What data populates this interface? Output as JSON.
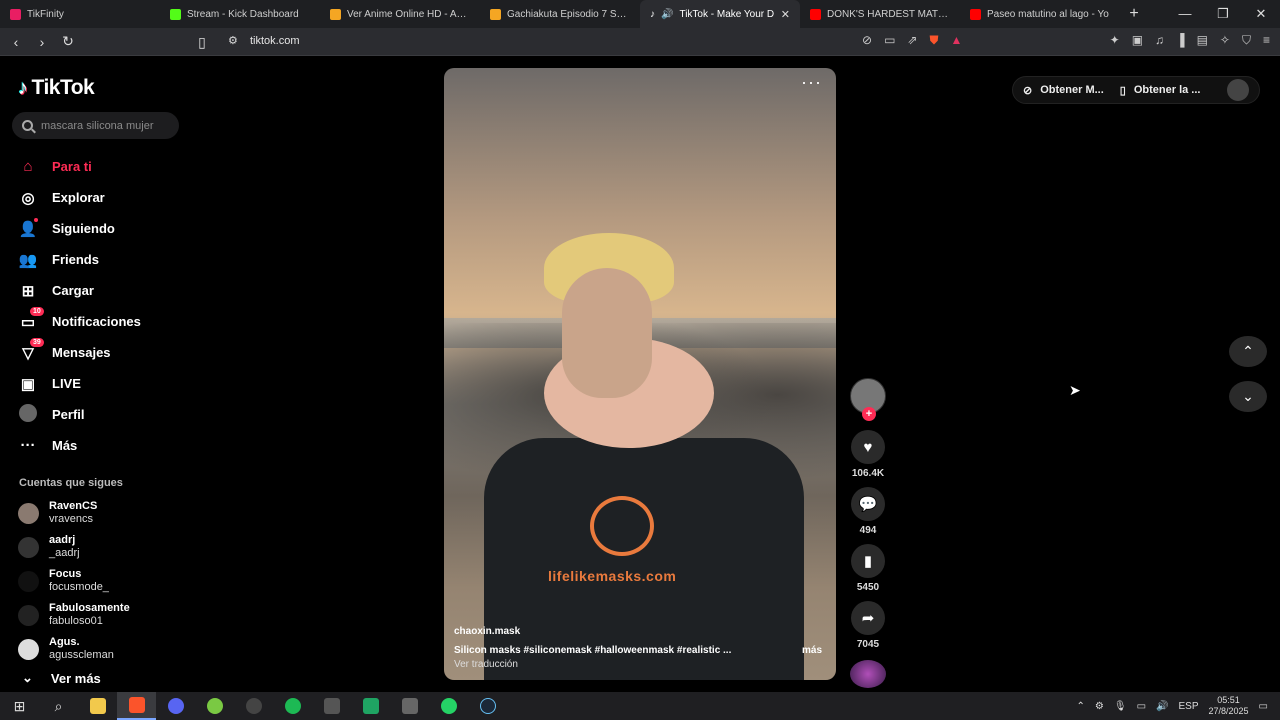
{
  "browser": {
    "tabs": [
      {
        "label": "TikFinity",
        "color": "#e91e63",
        "active": false
      },
      {
        "label": "Stream - Kick Dashboard",
        "color": "#53fc18",
        "active": false
      },
      {
        "label": "Ver Anime Online HD - Anim",
        "color": "#f5a623",
        "active": false
      },
      {
        "label": "Gachiakuta Episodio 7 Sub E",
        "color": "#f5a623",
        "active": false
      },
      {
        "label": "TikTok - Make Your D",
        "color": "#000000",
        "active": true
      },
      {
        "label": "DONK'S HARDEST MATCH E",
        "color": "#ff0000",
        "active": false
      },
      {
        "label": "Paseo matutino al lago - Yo",
        "color": "#ff0000",
        "active": false
      }
    ],
    "url": "tiktok.com"
  },
  "brand": {
    "name": "TikTok",
    "accent": "#fe2c55"
  },
  "search": {
    "placeholder": "mascara silicona mujer"
  },
  "nav": [
    {
      "label": "Para ti",
      "icon": "home-icon",
      "active": true
    },
    {
      "label": "Explorar",
      "icon": "compass-icon"
    },
    {
      "label": "Siguiendo",
      "icon": "following-icon"
    },
    {
      "label": "Friends",
      "icon": "friends-icon"
    },
    {
      "label": "Cargar",
      "icon": "upload-icon"
    },
    {
      "label": "Notificaciones",
      "icon": "notifications-icon",
      "badge": "10"
    },
    {
      "label": "Mensajes",
      "icon": "messages-icon",
      "badge": "39"
    },
    {
      "label": "LIVE",
      "icon": "live-icon"
    },
    {
      "label": "Perfil",
      "icon": "profile-icon"
    },
    {
      "label": "Más",
      "icon": "more-icon"
    }
  ],
  "following": {
    "title": "Cuentas que sigues",
    "accounts": [
      {
        "name": "RavenCS",
        "handle": "vravencs"
      },
      {
        "name": "aadrj",
        "handle": "_aadrj"
      },
      {
        "name": "Focus",
        "handle": "focusmode_"
      },
      {
        "name": "Fabulosamente",
        "handle": "fabuloso01"
      },
      {
        "name": "Agus.",
        "handle": "agusscleman"
      }
    ],
    "see_more": "Ver más"
  },
  "video": {
    "author": "chaoxin.mask",
    "description": "Silicon masks #siliconemask #halloweenmask #realistic ...",
    "more": "más",
    "translate": "Ver traducción",
    "shirt_text": "lifelikemasks.com"
  },
  "actions": {
    "likes": "106.4K",
    "comments": "494",
    "saves": "5450",
    "shares": "7045"
  },
  "topright": {
    "get_coins": "Obtener M...",
    "get_app": "Obtener la ..."
  },
  "taskbar": {
    "lang": "ESP",
    "time": "05:51",
    "date": "27/8/2025"
  }
}
